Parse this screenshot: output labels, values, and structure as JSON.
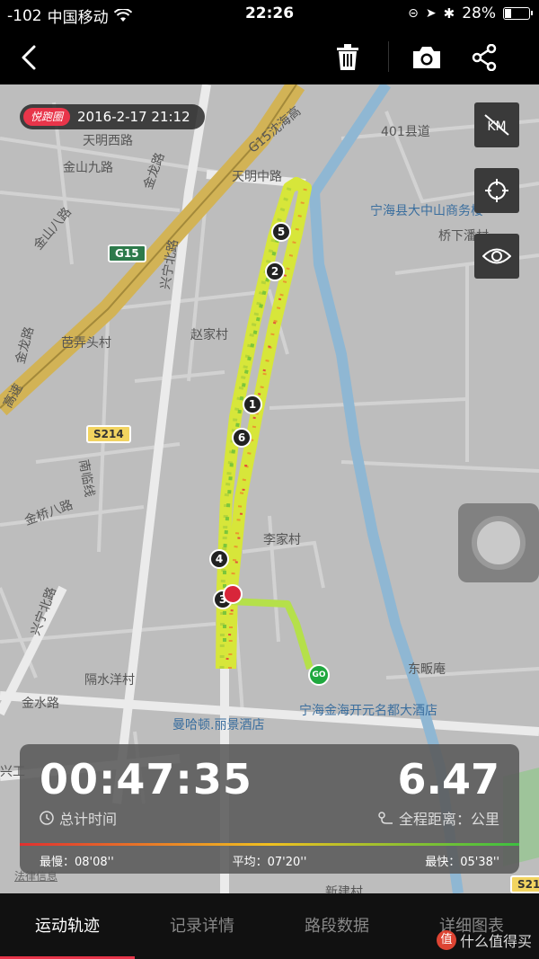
{
  "status": {
    "signal": "-102",
    "carrier": "中国移动",
    "time": "22:26",
    "battery": "28%"
  },
  "nav": {
    "back_icon": "chevron-left-icon",
    "delete_icon": "trash-icon",
    "camera_icon": "camera-icon",
    "share_icon": "share-icon"
  },
  "map": {
    "brand_tag": "悦跑圈",
    "date": "2016-2-17 21:12",
    "tools": [
      "km-toggle-icon",
      "locate-icon",
      "eye-icon"
    ],
    "labels": {
      "road_401": "401县道",
      "tianmingxi": "天明西路",
      "jinshanjiu": "金山九路",
      "jinlong": "金龙路",
      "tianmingzhong": "天明中路",
      "g15_shenhai": "G15沈海高",
      "business": "宁海县大中山商务楼",
      "qiaoxia": "桥下潘村",
      "jinshanba": "金山八路",
      "xingning_n1": "兴宁北路",
      "zhaojiacun": "赵家村",
      "panongtou": "芭弄头村",
      "jinlong2": "金龙路",
      "gaosu": "高速",
      "s214": "S214",
      "g15": "G15",
      "jinqiaoba": "金桥八路",
      "nanlin": "南临线",
      "lijiacun": "李家村",
      "xingning_n2": "兴宁北路",
      "geshuiyang": "隔水洋村",
      "dongfanan": "东畈庵",
      "jinshui": "金水路",
      "hotel1": "宁海金海开元名都大酒店",
      "hotel2": "曼哈顿.丽景酒店",
      "xinggong": "兴工",
      "xinjiancun": "新建村",
      "s21": "S21",
      "legal": "法律信息"
    },
    "markers": [
      "1",
      "2",
      "3",
      "4",
      "5",
      "6"
    ],
    "start_label": "GO"
  },
  "stats": {
    "duration": "00:47:35",
    "duration_label": "总计时间",
    "distance": "6.47",
    "distance_label": "全程距离：公里",
    "slowest": "最慢：08'08''",
    "average": "平均：07'20''",
    "fastest": "最快：05'38''"
  },
  "tabs": [
    "运动轨迹",
    "记录详情",
    "路段数据",
    "详细图表"
  ],
  "watermark": "什么值得买"
}
